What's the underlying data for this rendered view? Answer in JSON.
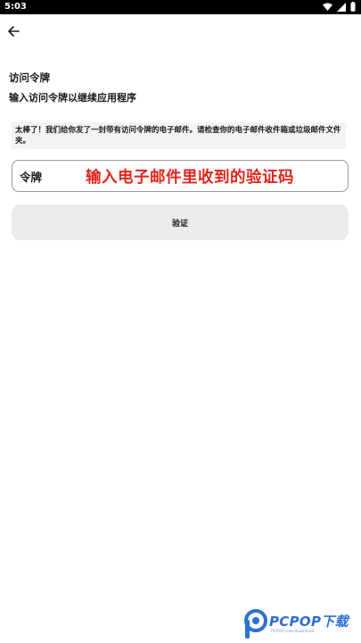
{
  "status_bar": {
    "time": "5:03",
    "icons": [
      "wifi-icon",
      "signal-icon",
      "battery-icon"
    ]
  },
  "nav": {
    "back_icon": "arrow-left-icon"
  },
  "page": {
    "title": "访问令牌",
    "subtitle": "输入访问令牌以继续应用程序",
    "notice": "太棒了！我们给你发了一封带有访问令牌的电子邮件。请检查你的电子邮件收件箱或垃圾邮件文件夹。"
  },
  "token_field": {
    "label": "令牌",
    "value": "",
    "placeholder": ""
  },
  "overlay_hint": "输入电子邮件里收到的验证码",
  "verify_button": {
    "label": "验证"
  },
  "watermark": {
    "text": "PCPOP下载",
    "small_text": "PCPOP.com/download"
  },
  "colors": {
    "status_bar": "#000000",
    "hint_red": "#e0261c",
    "button_bg": "#ececec",
    "watermark_blue": "#2e6fd1"
  }
}
